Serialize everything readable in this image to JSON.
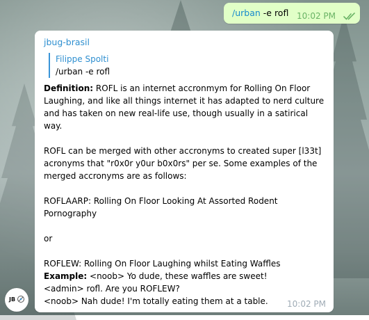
{
  "outgoing": {
    "command": "/urban",
    "args": " -e rofl",
    "time": "10:02 PM",
    "status_icon": "double-check-icon",
    "colors": {
      "bubble": "#e1ffc7",
      "command": "#168acd",
      "ticks": "#6ab365"
    }
  },
  "incoming": {
    "sender": "jbug-brasil",
    "reply": {
      "author": "Filippe Spolti",
      "text": "/urban -e rofl"
    },
    "definition_label": "Definition:",
    "definition_text": "ROFL is an internet accronmym for Rolling On Floor Laughing, and like all things internet it has adapted to nerd culture and has taken on new real-life use, though usually in a satirical way.",
    "paragraph2": "ROFL can be merged with other accronyms to created super [l33t] acronyms that \"r0x0r y0ur b0x0rs\" per se. Some examples of the merged accronyms are as follows:",
    "paragraph3": "ROFLAARP: Rolling On Floor Looking At Assorted Rodent Pornography",
    "paragraph4": "or",
    "paragraph5": "ROFLEW: Rolling On Floor Laughing whilst Eating Waffles",
    "example_label": "Example:",
    "example_line1": "<noob> Yo dude, these waffles are sweet!",
    "example_line2": "<admin> rofl. Are you ROFLEW?",
    "example_line3": "<noob> Nah dude! I'm totally eating them at a table.",
    "time": "10:02 PM",
    "colors": {
      "sender": "#2e8fd0",
      "reply_bar": "#3a95d8",
      "time": "#a0acb6"
    }
  },
  "avatar": {
    "text": "JB",
    "icon": "jbug-logo-icon"
  }
}
